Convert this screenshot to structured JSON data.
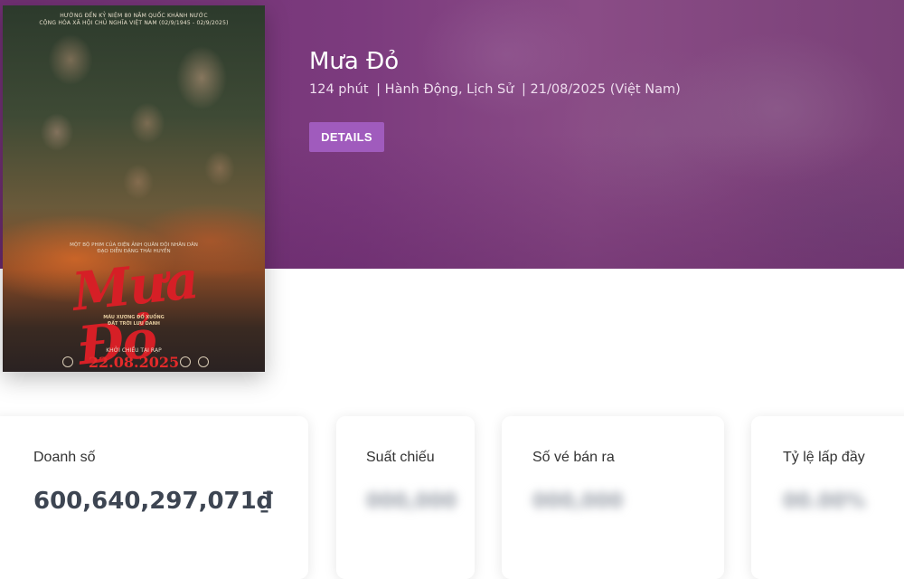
{
  "movie": {
    "title": "Mưa Đỏ",
    "duration": "124 phút",
    "genres": "| Hành Động, Lịch Sử",
    "release": "| 21/08/2025 (Việt Nam)",
    "details_label": "DETAILS"
  },
  "poster": {
    "top_line_1": "HƯỚNG ĐẾN KỶ NIỆM 80 NĂM QUỐC KHÁNH NƯỚC",
    "top_line_2": "CỘNG HÒA XÃ HỘI CHỦ NGHĨA VIỆT NAM (02/9/1945 - 02/9/2025)",
    "credits": "MỘT BỘ PHIM CỦA ĐIỆN ẢNH QUÂN ĐỘI NHÂN DÂN",
    "director": "ĐẠO DIỄN ĐẶNG THÁI HUYỀN",
    "title_art": "Mưa Đỏ",
    "tagline_1": "MÁU XƯƠNG ĐỔ XUỐNG",
    "tagline_2": "ĐẤT TRỜI LƯU DANH",
    "release_label": "KHỞI CHIẾU TẠI RẠP",
    "release_date": "22.08.2025"
  },
  "stats": [
    {
      "label": "Doanh số",
      "value": "600,640,297,071₫",
      "blurred": false
    },
    {
      "label": "Suất chiếu",
      "value": "000,000",
      "blurred": true
    },
    {
      "label": "Số vé bán ra",
      "value": "000,000",
      "blurred": true
    },
    {
      "label": "Tỷ lệ lấp đầy",
      "value": "00.00%",
      "blurred": true
    }
  ],
  "colors": {
    "hero_purple": "#7c3b7e",
    "button_purple": "#a05bbd",
    "value_dark": "#3d4552"
  }
}
